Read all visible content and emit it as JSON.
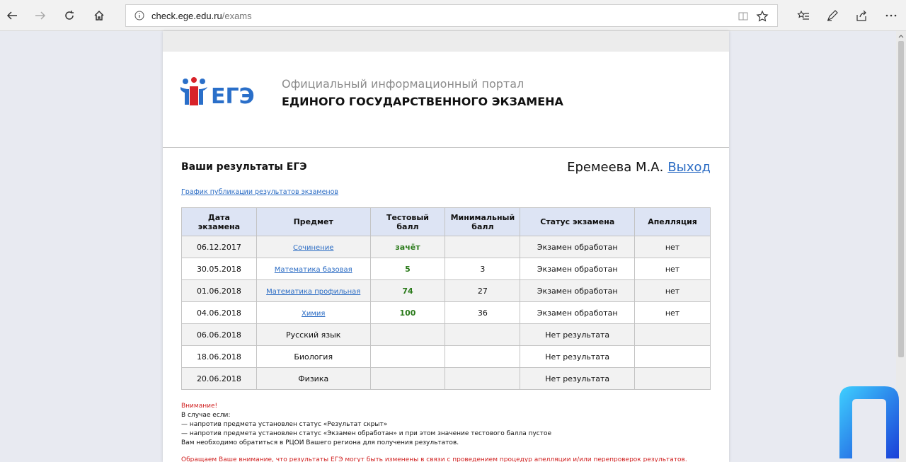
{
  "browser": {
    "url_host": "check.ege.edu.ru",
    "url_path": "/exams"
  },
  "header": {
    "portal_line1": "Официальный информационный портал",
    "portal_line2": "ЕДИНОГО ГОСУДАРСТВЕННОГО ЭКЗАМЕНА",
    "logo_text": "ЕГЭ"
  },
  "results": {
    "title": "Ваши результаты ЕГЭ",
    "user_name": "Еремеева М.А.",
    "logout_label": "Выход",
    "schedule_link": "График публикации результатов экзаменов",
    "columns": [
      {
        "line1": "Дата",
        "line2": "экзамена"
      },
      {
        "line1": "Предмет",
        "line2": ""
      },
      {
        "line1": "Тестовый",
        "line2": "балл"
      },
      {
        "line1": "Минимальный",
        "line2": "балл"
      },
      {
        "line1": "Статус экзамена",
        "line2": ""
      },
      {
        "line1": "Апелляция",
        "line2": ""
      }
    ],
    "rows": [
      {
        "date": "06.12.2017",
        "subject": "Сочинение",
        "score": "зачёт",
        "min": "",
        "status": "Экзамен обработан",
        "appeal": "нет"
      },
      {
        "date": "30.05.2018",
        "subject": "Математика базовая",
        "score": "5",
        "min": "3",
        "status": "Экзамен обработан",
        "appeal": "нет"
      },
      {
        "date": "01.06.2018",
        "subject": "Математика профильная",
        "score": "74",
        "min": "27",
        "status": "Экзамен обработан",
        "appeal": "нет"
      },
      {
        "date": "04.06.2018",
        "subject": "Химия",
        "score": "100",
        "min": "36",
        "status": "Экзамен обработан",
        "appeal": "нет"
      },
      {
        "date": "06.06.2018",
        "subject": "Русский язык",
        "score": "",
        "min": "",
        "status": "Нет результата",
        "appeal": ""
      },
      {
        "date": "18.06.2018",
        "subject": "Биология",
        "score": "",
        "min": "",
        "status": "Нет результата",
        "appeal": ""
      },
      {
        "date": "20.06.2018",
        "subject": "Физика",
        "score": "",
        "min": "",
        "status": "Нет результата",
        "appeal": ""
      }
    ]
  },
  "notice": {
    "warning": "Внимание!",
    "line1": "В случае если:",
    "line2": "— напротив предмета установлен статус «Результат скрыт»",
    "line3": "— напротив предмета установлен статус «Экзамен обработан» и при этом значение тестового балла пустое",
    "line4": "Вам необходимо обратиться в РЦОИ Вашего региона для получения результатов.",
    "bottom": "Обращаем Ваше внимание, что результаты ЕГЭ могут быть изменены в связи с проведением процедур апелляции и/или перепроверок результатов."
  },
  "colors": {
    "link": "#2b6cc4",
    "score_green": "#2a7a1a",
    "warning_red": "#d02020",
    "header_bg": "#dde4f4"
  }
}
